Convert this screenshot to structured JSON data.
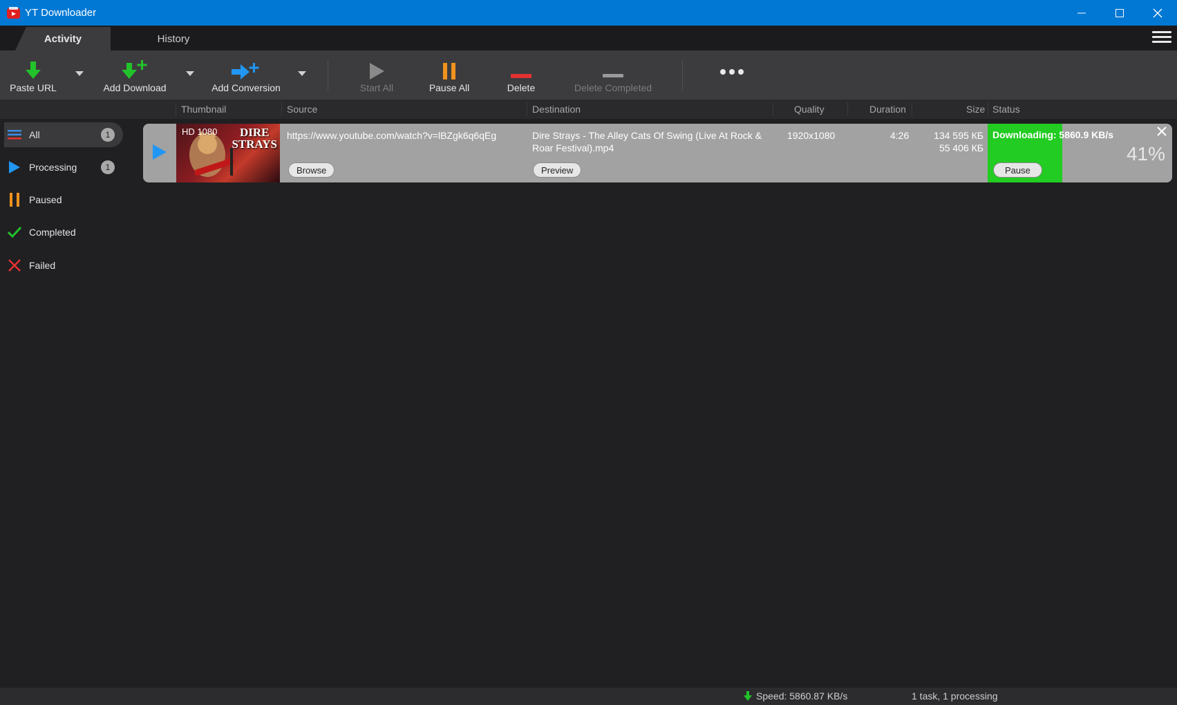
{
  "window": {
    "title": "YT Downloader",
    "accent": "#0078d4"
  },
  "tabs": [
    {
      "label": "Activity",
      "active": true
    },
    {
      "label": "History",
      "active": false
    }
  ],
  "toolbar": {
    "paste_url": "Paste URL",
    "add_download": "Add Download",
    "add_conversion": "Add Conversion",
    "start_all": "Start All",
    "pause_all": "Pause All",
    "delete": "Delete",
    "delete_completed": "Delete Completed",
    "more_icon": "more-dots-icon"
  },
  "columns": {
    "thumbnail": "Thumbnail",
    "source": "Source",
    "destination": "Destination",
    "quality": "Quality",
    "duration": "Duration",
    "size": "Size",
    "status": "Status"
  },
  "sidebar": {
    "items": [
      {
        "label": "All",
        "count": "1",
        "icon": "list-icon"
      },
      {
        "label": "Processing",
        "count": "1",
        "icon": "play-icon"
      },
      {
        "label": "Paused",
        "icon": "pause-icon"
      },
      {
        "label": "Completed",
        "icon": "check-icon"
      },
      {
        "label": "Failed",
        "icon": "x-icon"
      }
    ]
  },
  "task": {
    "thumb_badge": "HD 1080",
    "thumb_title_line1": "DIRE",
    "thumb_title_line2": "STRAYS",
    "source_url": "https://www.youtube.com/watch?v=lBZgk6q6qEg",
    "browse_label": "Browse",
    "destination_line1": "Dire Strays - The Alley Cats Of Swing (Live At Rock &",
    "destination_line2": "Roar Festival).mp4",
    "preview_label": "Preview",
    "quality": "1920x1080",
    "duration": "4:26",
    "size_total": "134 595 КБ",
    "size_done": "55 406 КБ",
    "status": "Downloading: 5860.9 KB/s",
    "status_color": "#22cc22",
    "pause_label": "Pause",
    "percent": "41%",
    "progress": 0.41
  },
  "statusbar": {
    "speed": "Speed: 5860.87 KB/s",
    "tasks": "1 task, 1 processing"
  }
}
